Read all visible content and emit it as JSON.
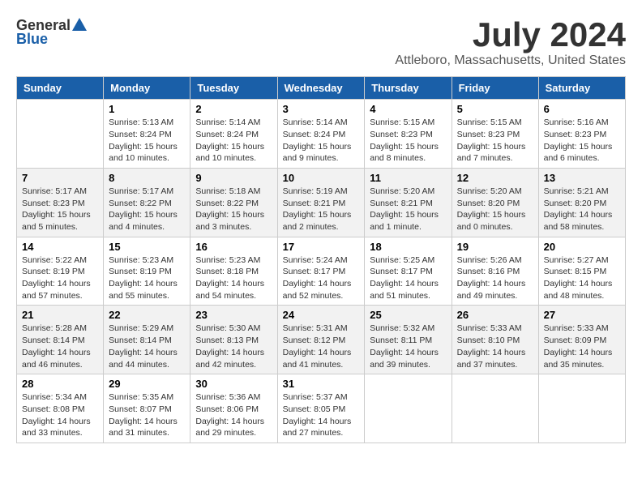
{
  "header": {
    "logo_general": "General",
    "logo_blue": "Blue",
    "month": "July 2024",
    "location": "Attleboro, Massachusetts, United States"
  },
  "days_of_week": [
    "Sunday",
    "Monday",
    "Tuesday",
    "Wednesday",
    "Thursday",
    "Friday",
    "Saturday"
  ],
  "weeks": [
    [
      {
        "day": "",
        "sunrise": "",
        "sunset": "",
        "daylight": ""
      },
      {
        "day": "1",
        "sunrise": "Sunrise: 5:13 AM",
        "sunset": "Sunset: 8:24 PM",
        "daylight": "Daylight: 15 hours and 10 minutes."
      },
      {
        "day": "2",
        "sunrise": "Sunrise: 5:14 AM",
        "sunset": "Sunset: 8:24 PM",
        "daylight": "Daylight: 15 hours and 10 minutes."
      },
      {
        "day": "3",
        "sunrise": "Sunrise: 5:14 AM",
        "sunset": "Sunset: 8:24 PM",
        "daylight": "Daylight: 15 hours and 9 minutes."
      },
      {
        "day": "4",
        "sunrise": "Sunrise: 5:15 AM",
        "sunset": "Sunset: 8:23 PM",
        "daylight": "Daylight: 15 hours and 8 minutes."
      },
      {
        "day": "5",
        "sunrise": "Sunrise: 5:15 AM",
        "sunset": "Sunset: 8:23 PM",
        "daylight": "Daylight: 15 hours and 7 minutes."
      },
      {
        "day": "6",
        "sunrise": "Sunrise: 5:16 AM",
        "sunset": "Sunset: 8:23 PM",
        "daylight": "Daylight: 15 hours and 6 minutes."
      }
    ],
    [
      {
        "day": "7",
        "sunrise": "Sunrise: 5:17 AM",
        "sunset": "Sunset: 8:23 PM",
        "daylight": "Daylight: 15 hours and 5 minutes."
      },
      {
        "day": "8",
        "sunrise": "Sunrise: 5:17 AM",
        "sunset": "Sunset: 8:22 PM",
        "daylight": "Daylight: 15 hours and 4 minutes."
      },
      {
        "day": "9",
        "sunrise": "Sunrise: 5:18 AM",
        "sunset": "Sunset: 8:22 PM",
        "daylight": "Daylight: 15 hours and 3 minutes."
      },
      {
        "day": "10",
        "sunrise": "Sunrise: 5:19 AM",
        "sunset": "Sunset: 8:21 PM",
        "daylight": "Daylight: 15 hours and 2 minutes."
      },
      {
        "day": "11",
        "sunrise": "Sunrise: 5:20 AM",
        "sunset": "Sunset: 8:21 PM",
        "daylight": "Daylight: 15 hours and 1 minute."
      },
      {
        "day": "12",
        "sunrise": "Sunrise: 5:20 AM",
        "sunset": "Sunset: 8:20 PM",
        "daylight": "Daylight: 15 hours and 0 minutes."
      },
      {
        "day": "13",
        "sunrise": "Sunrise: 5:21 AM",
        "sunset": "Sunset: 8:20 PM",
        "daylight": "Daylight: 14 hours and 58 minutes."
      }
    ],
    [
      {
        "day": "14",
        "sunrise": "Sunrise: 5:22 AM",
        "sunset": "Sunset: 8:19 PM",
        "daylight": "Daylight: 14 hours and 57 minutes."
      },
      {
        "day": "15",
        "sunrise": "Sunrise: 5:23 AM",
        "sunset": "Sunset: 8:19 PM",
        "daylight": "Daylight: 14 hours and 55 minutes."
      },
      {
        "day": "16",
        "sunrise": "Sunrise: 5:23 AM",
        "sunset": "Sunset: 8:18 PM",
        "daylight": "Daylight: 14 hours and 54 minutes."
      },
      {
        "day": "17",
        "sunrise": "Sunrise: 5:24 AM",
        "sunset": "Sunset: 8:17 PM",
        "daylight": "Daylight: 14 hours and 52 minutes."
      },
      {
        "day": "18",
        "sunrise": "Sunrise: 5:25 AM",
        "sunset": "Sunset: 8:17 PM",
        "daylight": "Daylight: 14 hours and 51 minutes."
      },
      {
        "day": "19",
        "sunrise": "Sunrise: 5:26 AM",
        "sunset": "Sunset: 8:16 PM",
        "daylight": "Daylight: 14 hours and 49 minutes."
      },
      {
        "day": "20",
        "sunrise": "Sunrise: 5:27 AM",
        "sunset": "Sunset: 8:15 PM",
        "daylight": "Daylight: 14 hours and 48 minutes."
      }
    ],
    [
      {
        "day": "21",
        "sunrise": "Sunrise: 5:28 AM",
        "sunset": "Sunset: 8:14 PM",
        "daylight": "Daylight: 14 hours and 46 minutes."
      },
      {
        "day": "22",
        "sunrise": "Sunrise: 5:29 AM",
        "sunset": "Sunset: 8:14 PM",
        "daylight": "Daylight: 14 hours and 44 minutes."
      },
      {
        "day": "23",
        "sunrise": "Sunrise: 5:30 AM",
        "sunset": "Sunset: 8:13 PM",
        "daylight": "Daylight: 14 hours and 42 minutes."
      },
      {
        "day": "24",
        "sunrise": "Sunrise: 5:31 AM",
        "sunset": "Sunset: 8:12 PM",
        "daylight": "Daylight: 14 hours and 41 minutes."
      },
      {
        "day": "25",
        "sunrise": "Sunrise: 5:32 AM",
        "sunset": "Sunset: 8:11 PM",
        "daylight": "Daylight: 14 hours and 39 minutes."
      },
      {
        "day": "26",
        "sunrise": "Sunrise: 5:33 AM",
        "sunset": "Sunset: 8:10 PM",
        "daylight": "Daylight: 14 hours and 37 minutes."
      },
      {
        "day": "27",
        "sunrise": "Sunrise: 5:33 AM",
        "sunset": "Sunset: 8:09 PM",
        "daylight": "Daylight: 14 hours and 35 minutes."
      }
    ],
    [
      {
        "day": "28",
        "sunrise": "Sunrise: 5:34 AM",
        "sunset": "Sunset: 8:08 PM",
        "daylight": "Daylight: 14 hours and 33 minutes."
      },
      {
        "day": "29",
        "sunrise": "Sunrise: 5:35 AM",
        "sunset": "Sunset: 8:07 PM",
        "daylight": "Daylight: 14 hours and 31 minutes."
      },
      {
        "day": "30",
        "sunrise": "Sunrise: 5:36 AM",
        "sunset": "Sunset: 8:06 PM",
        "daylight": "Daylight: 14 hours and 29 minutes."
      },
      {
        "day": "31",
        "sunrise": "Sunrise: 5:37 AM",
        "sunset": "Sunset: 8:05 PM",
        "daylight": "Daylight: 14 hours and 27 minutes."
      },
      {
        "day": "",
        "sunrise": "",
        "sunset": "",
        "daylight": ""
      },
      {
        "day": "",
        "sunrise": "",
        "sunset": "",
        "daylight": ""
      },
      {
        "day": "",
        "sunrise": "",
        "sunset": "",
        "daylight": ""
      }
    ]
  ]
}
